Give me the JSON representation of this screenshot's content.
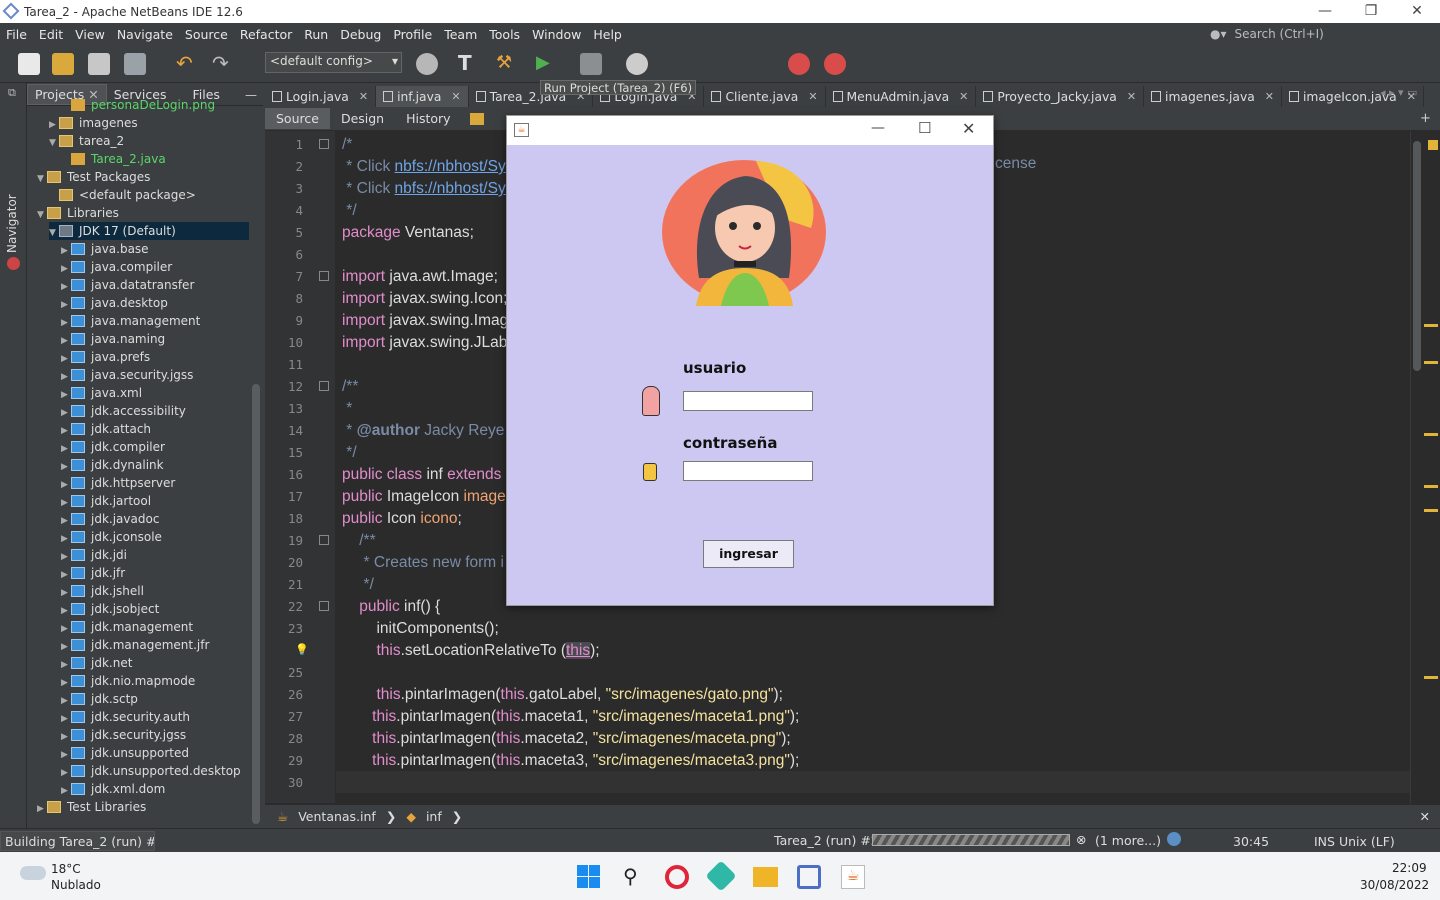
{
  "window": {
    "title": "Tarea_2 - Apache NetBeans IDE 12.6"
  },
  "menu": [
    "File",
    "Edit",
    "View",
    "Navigate",
    "Source",
    "Refactor",
    "Run",
    "Debug",
    "Profile",
    "Team",
    "Tools",
    "Window",
    "Help"
  ],
  "search": {
    "placeholder": "Search (Ctrl+I)"
  },
  "toolbar": {
    "config": "<default config>",
    "tooltip": "Run Project (Tarea_2) (F6)"
  },
  "side_tabs": {
    "navigator": "Navigator"
  },
  "project_tabs": [
    "Projects",
    "Services",
    "Files"
  ],
  "tree": [
    {
      "label": "personaDeLogin.png",
      "icon": "image-file-icon",
      "depth": 3,
      "arrow": "",
      "color": "#5bd56b"
    },
    {
      "label": "imagenes",
      "icon": "package-icon",
      "depth": 2,
      "arrow": "▶",
      "color": "#dddddd"
    },
    {
      "label": "tarea_2",
      "icon": "package-icon",
      "depth": 2,
      "arrow": "▼",
      "color": "#dddddd"
    },
    {
      "label": "Tarea_2.java",
      "icon": "java-file-icon",
      "depth": 3,
      "arrow": "",
      "color": "#5bd56b"
    },
    {
      "label": "Test Packages",
      "icon": "folder-icon",
      "depth": 1,
      "arrow": "▼",
      "color": "#dddddd"
    },
    {
      "label": "<default package>",
      "icon": "package-icon",
      "depth": 2,
      "arrow": "",
      "color": "#dddddd"
    },
    {
      "label": "Libraries",
      "icon": "folder-icon",
      "depth": 1,
      "arrow": "▼",
      "color": "#dddddd"
    },
    {
      "label": "JDK 17 (Default)",
      "icon": "jdk-icon",
      "depth": 2,
      "arrow": "▼",
      "color": "#dddddd"
    },
    {
      "label": "java.base",
      "icon": "module-icon",
      "depth": 3,
      "arrow": "▶",
      "color": "#dddddd"
    },
    {
      "label": "java.compiler",
      "icon": "module-icon",
      "depth": 3,
      "arrow": "▶",
      "color": "#dddddd"
    },
    {
      "label": "java.datatransfer",
      "icon": "module-icon",
      "depth": 3,
      "arrow": "▶",
      "color": "#dddddd"
    },
    {
      "label": "java.desktop",
      "icon": "module-icon",
      "depth": 3,
      "arrow": "▶",
      "color": "#dddddd"
    },
    {
      "label": "java.management",
      "icon": "module-icon",
      "depth": 3,
      "arrow": "▶",
      "color": "#dddddd"
    },
    {
      "label": "java.naming",
      "icon": "module-icon",
      "depth": 3,
      "arrow": "▶",
      "color": "#dddddd"
    },
    {
      "label": "java.prefs",
      "icon": "module-icon",
      "depth": 3,
      "arrow": "▶",
      "color": "#dddddd"
    },
    {
      "label": "java.security.jgss",
      "icon": "module-icon",
      "depth": 3,
      "arrow": "▶",
      "color": "#dddddd"
    },
    {
      "label": "java.xml",
      "icon": "module-icon",
      "depth": 3,
      "arrow": "▶",
      "color": "#dddddd"
    },
    {
      "label": "jdk.accessibility",
      "icon": "module-icon",
      "depth": 3,
      "arrow": "▶",
      "color": "#dddddd"
    },
    {
      "label": "jdk.attach",
      "icon": "module-icon",
      "depth": 3,
      "arrow": "▶",
      "color": "#dddddd"
    },
    {
      "label": "jdk.compiler",
      "icon": "module-icon",
      "depth": 3,
      "arrow": "▶",
      "color": "#dddddd"
    },
    {
      "label": "jdk.dynalink",
      "icon": "module-icon",
      "depth": 3,
      "arrow": "▶",
      "color": "#dddddd"
    },
    {
      "label": "jdk.httpserver",
      "icon": "module-icon",
      "depth": 3,
      "arrow": "▶",
      "color": "#dddddd"
    },
    {
      "label": "jdk.jartool",
      "icon": "module-icon",
      "depth": 3,
      "arrow": "▶",
      "color": "#dddddd"
    },
    {
      "label": "jdk.javadoc",
      "icon": "module-icon",
      "depth": 3,
      "arrow": "▶",
      "color": "#dddddd"
    },
    {
      "label": "jdk.jconsole",
      "icon": "module-icon",
      "depth": 3,
      "arrow": "▶",
      "color": "#dddddd"
    },
    {
      "label": "jdk.jdi",
      "icon": "module-icon",
      "depth": 3,
      "arrow": "▶",
      "color": "#dddddd"
    },
    {
      "label": "jdk.jfr",
      "icon": "module-icon",
      "depth": 3,
      "arrow": "▶",
      "color": "#dddddd"
    },
    {
      "label": "jdk.jshell",
      "icon": "module-icon",
      "depth": 3,
      "arrow": "▶",
      "color": "#dddddd"
    },
    {
      "label": "jdk.jsobject",
      "icon": "module-icon",
      "depth": 3,
      "arrow": "▶",
      "color": "#dddddd"
    },
    {
      "label": "jdk.management",
      "icon": "module-icon",
      "depth": 3,
      "arrow": "▶",
      "color": "#dddddd"
    },
    {
      "label": "jdk.management.jfr",
      "icon": "module-icon",
      "depth": 3,
      "arrow": "▶",
      "color": "#dddddd"
    },
    {
      "label": "jdk.net",
      "icon": "module-icon",
      "depth": 3,
      "arrow": "▶",
      "color": "#dddddd"
    },
    {
      "label": "jdk.nio.mapmode",
      "icon": "module-icon",
      "depth": 3,
      "arrow": "▶",
      "color": "#dddddd"
    },
    {
      "label": "jdk.sctp",
      "icon": "module-icon",
      "depth": 3,
      "arrow": "▶",
      "color": "#dddddd"
    },
    {
      "label": "jdk.security.auth",
      "icon": "module-icon",
      "depth": 3,
      "arrow": "▶",
      "color": "#dddddd"
    },
    {
      "label": "jdk.security.jgss",
      "icon": "module-icon",
      "depth": 3,
      "arrow": "▶",
      "color": "#dddddd"
    },
    {
      "label": "jdk.unsupported",
      "icon": "module-icon",
      "depth": 3,
      "arrow": "▶",
      "color": "#dddddd"
    },
    {
      "label": "jdk.unsupported.desktop",
      "icon": "module-icon",
      "depth": 3,
      "arrow": "▶",
      "color": "#dddddd"
    },
    {
      "label": "jdk.xml.dom",
      "icon": "module-icon",
      "depth": 3,
      "arrow": "▶",
      "color": "#dddddd"
    },
    {
      "label": "Test Libraries",
      "icon": "folder-icon",
      "depth": 1,
      "arrow": "▶",
      "color": "#dddddd"
    }
  ],
  "editor_tabs": [
    {
      "label": "Login.java",
      "highlight": false
    },
    {
      "label": "inf.java",
      "highlight": true
    },
    {
      "label": "Tarea_2.java",
      "highlight": false
    },
    {
      "label": "Login.java",
      "highlight": false
    },
    {
      "label": "Cliente.java",
      "highlight": false
    },
    {
      "label": "MenuAdmin.java",
      "highlight": false
    },
    {
      "label": "Proyecto_Jacky.java",
      "highlight": false
    },
    {
      "label": "imagenes.java",
      "highlight": false
    },
    {
      "label": "imageIcon.java",
      "highlight": false
    }
  ],
  "sub_tabs": [
    "Source",
    "Design",
    "History"
  ],
  "line_numbers": [
    "1",
    "2",
    "3",
    "4",
    "5",
    "6",
    "7",
    "8",
    "9",
    "10",
    "11",
    "12",
    "13",
    "14",
    "15",
    "16",
    "17",
    "18",
    "19",
    "20",
    "21",
    "22",
    "23",
    "",
    "25",
    "26",
    "27",
    "28",
    "29",
    "30"
  ],
  "code": [
    [
      [
        "cm",
        "/*"
      ]
    ],
    [
      [
        "cm",
        " * Click "
      ],
      [
        "lk",
        "nbfs://nbhost/Sy"
      ]
    ],
    [
      [
        "cm",
        " * Click "
      ],
      [
        "lk",
        "nbfs://nbhost/Sy"
      ]
    ],
    [
      [
        "cm",
        " */"
      ]
    ],
    [
      [
        "kw",
        "package "
      ],
      [
        "",
        "Ventanas;"
      ]
    ],
    [],
    [
      [
        "kw",
        "import "
      ],
      [
        "",
        "java.awt.Image;"
      ]
    ],
    [
      [
        "kw",
        "import "
      ],
      [
        "",
        "javax.swing.Icon;"
      ]
    ],
    [
      [
        "kw",
        "import "
      ],
      [
        "",
        "javax.swing.Imag"
      ]
    ],
    [
      [
        "kw",
        "import "
      ],
      [
        "",
        "javax.swing.JLab"
      ]
    ],
    [],
    [
      [
        "cm",
        "/**"
      ]
    ],
    [
      [
        "cm",
        " *"
      ]
    ],
    [
      [
        "cm",
        " * "
      ],
      [
        "cmb",
        "@author"
      ],
      [
        "cm",
        " Jacky Reye"
      ]
    ],
    [
      [
        "cm",
        " */"
      ]
    ],
    [
      [
        "kw",
        "public class "
      ],
      [
        "",
        "inf "
      ],
      [
        "kw",
        "extends"
      ]
    ],
    [
      [
        "kw",
        "public "
      ],
      [
        "",
        "ImageIcon "
      ],
      [
        "fld",
        "image"
      ]
    ],
    [
      [
        "kw",
        "public "
      ],
      [
        "",
        "Icon "
      ],
      [
        "fld",
        "icono"
      ],
      [
        "",
        ";"
      ]
    ],
    [
      [
        "cm",
        "    /**"
      ]
    ],
    [
      [
        "cm",
        "     * Creates new form i"
      ]
    ],
    [
      [
        "cm",
        "     */"
      ]
    ],
    [
      [
        "kw",
        "    public "
      ],
      [
        "",
        "inf() {"
      ]
    ],
    [
      [
        "",
        "        initComponents();"
      ]
    ],
    [
      [
        "kw",
        "        this"
      ],
      [
        "",
        ".setLocationRelativeTo ("
      ],
      [
        "kwhl",
        "this"
      ],
      [
        "",
        ");"
      ]
    ],
    [],
    [
      [
        "kw",
        "        this"
      ],
      [
        "",
        ".pintarImagen("
      ],
      [
        "kw",
        "this"
      ],
      [
        "",
        ".gatoLabel, "
      ],
      [
        "st",
        "\"src/imagenes/gato.png\""
      ],
      [
        "",
        ");"
      ]
    ],
    [
      [
        "kw",
        "       this"
      ],
      [
        "",
        ".pintarImagen("
      ],
      [
        "kw",
        "this"
      ],
      [
        "",
        ".maceta1, "
      ],
      [
        "st",
        "\"src/imagenes/maceta1.png\""
      ],
      [
        "",
        ");"
      ]
    ],
    [
      [
        "kw",
        "       this"
      ],
      [
        "",
        ".pintarImagen("
      ],
      [
        "kw",
        "this"
      ],
      [
        "",
        ".maceta2, "
      ],
      [
        "st",
        "\"src/imagenes/maceta.png\""
      ],
      [
        "",
        ");"
      ]
    ],
    [
      [
        "kw",
        "       this"
      ],
      [
        "",
        ".pintarImagen("
      ],
      [
        "kw",
        "this"
      ],
      [
        "",
        ".maceta3, "
      ],
      [
        "st",
        "\"src/imagenes/maceta3.png\""
      ],
      [
        "",
        ");"
      ]
    ],
    [
      [
        "kw",
        "       this"
      ],
      [
        "",
        ".pintarImagen("
      ],
      [
        "kw",
        "this"
      ],
      [
        "",
        ".maceta4, "
      ],
      [
        "st",
        "\"src/imagenes/maceta4.png\""
      ],
      [
        "",
        ");"
      ]
    ]
  ],
  "code_tail_line2": "cense",
  "breadcrumb": [
    "Ventanas.inf",
    "inf"
  ],
  "status": {
    "left": "Building Tarea_2 (run) #2...",
    "task": "Tarea_2 (run) #2",
    "more": "(1 more...)",
    "position": "30:45",
    "mode": "INS Unix (LF)"
  },
  "dialog": {
    "usuario_label": "usuario",
    "password_label": "contraseña",
    "usuario_value": "",
    "password_value": "",
    "button": "ingresar"
  },
  "taskbar": {
    "temperature": "18°C",
    "weather": "Nublado",
    "time": "22:09",
    "date": "30/08/2022"
  },
  "colors": {
    "accent": "#4a87d6",
    "dialog_bg": "#cdc8f2",
    "keyword": "#e28dcb",
    "string": "#f4e29e"
  }
}
